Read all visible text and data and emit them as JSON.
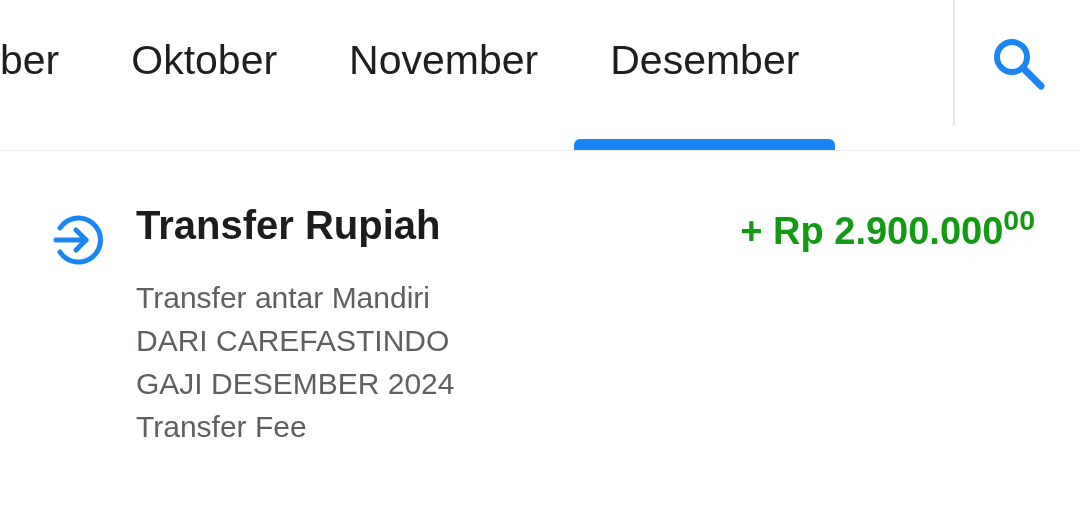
{
  "tabs": [
    {
      "label": "ber",
      "selected": false
    },
    {
      "label": "Oktober",
      "selected": false
    },
    {
      "label": "November",
      "selected": false
    },
    {
      "label": "Desember",
      "selected": true
    }
  ],
  "transactions": [
    {
      "kind": "incoming",
      "title": "Transfer Rupiah",
      "amount": "+ Rp 2.900.000$^{00}$",
      "details": [
        "Transfer antar Mandiri",
        "DARI CAREFASTINDO",
        "GAJI DESEMBER 2024",
        "Transfer Fee"
      ]
    }
  ]
}
